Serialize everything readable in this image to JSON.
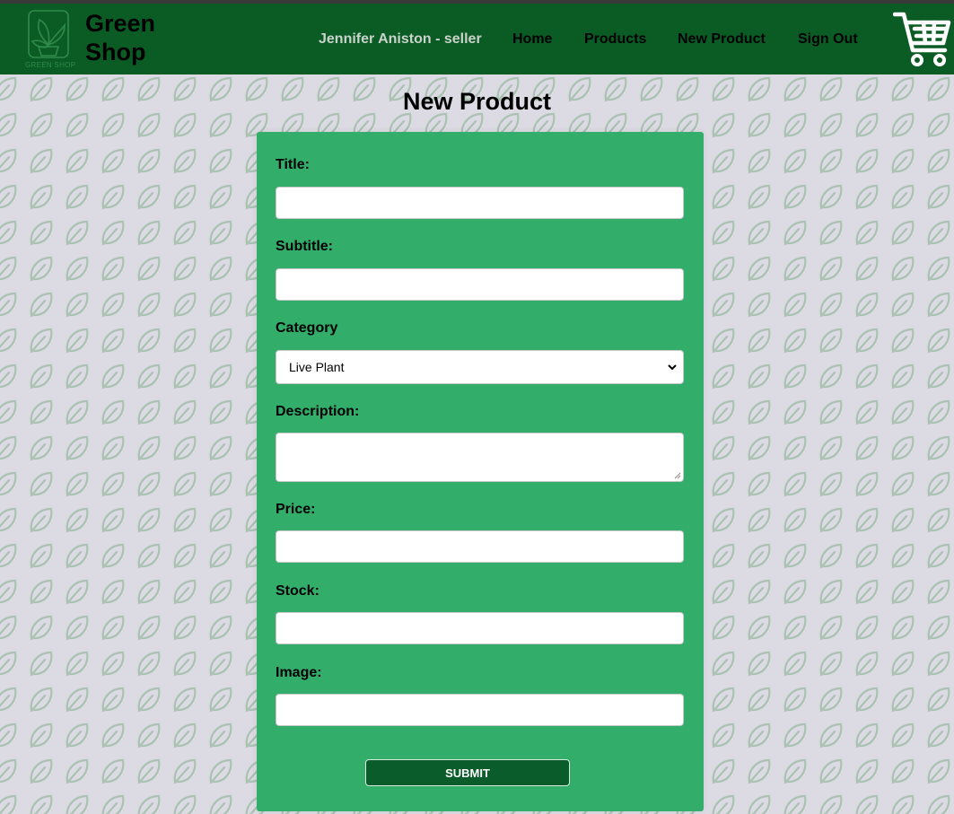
{
  "header": {
    "brand_line1": "Green",
    "brand_line2": "Shop",
    "logo_text": "GREEN SHOP",
    "user": "Jennifer Aniston - seller",
    "nav": {
      "home": "Home",
      "products": "Products",
      "new_product": "New Product",
      "sign_out": "Sign Out"
    },
    "cart_icon": "shopping-cart-icon",
    "logo_icon": "plant-pot-icon"
  },
  "page": {
    "title": "New Product"
  },
  "form": {
    "title_label": "Title:",
    "title_value": "",
    "subtitle_label": "Subtitle:",
    "subtitle_value": "",
    "category_label": "Category",
    "category_selected": "Live Plant",
    "description_label": "Description:",
    "description_value": "",
    "price_label": "Price:",
    "price_value": "",
    "stock_label": "Stock:",
    "stock_value": "",
    "image_label": "Image:",
    "image_value": "",
    "submit_label": "SUBMIT"
  },
  "colors": {
    "header_bg": "#0b5c24",
    "card_bg": "#32ad6a",
    "page_bg": "#dcdae2",
    "button_bg": "#0b5c2b",
    "leaf_pattern": "#a9c2b1"
  },
  "background": {
    "pattern_icon": "leaf-icon"
  }
}
